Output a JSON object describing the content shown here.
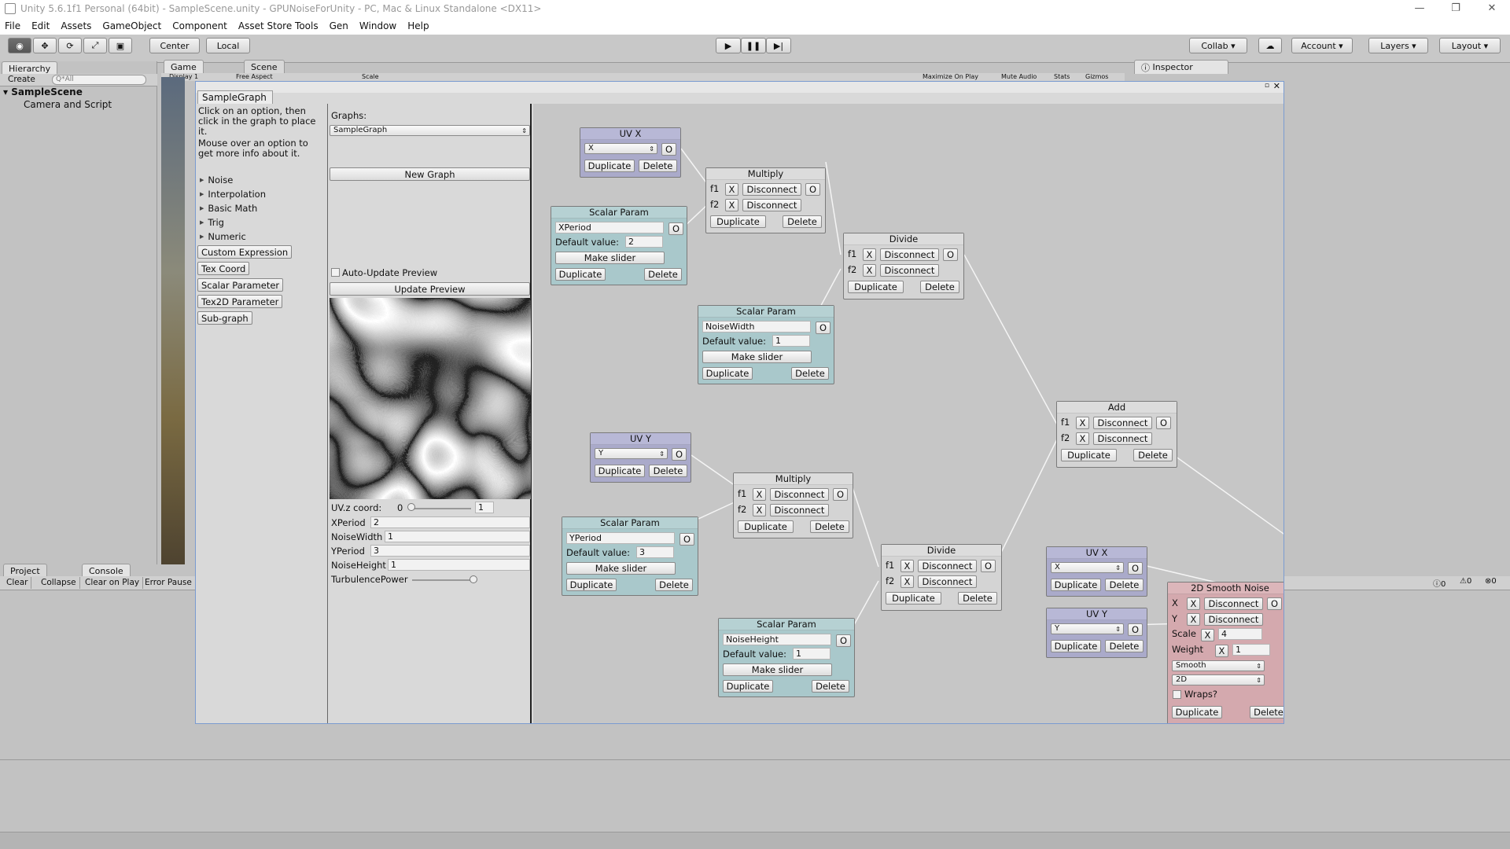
{
  "window": {
    "title": "Unity 5.6.1f1 Personal (64bit) - SampleScene.unity - GPUNoiseForUnity - PC, Mac & Linux Standalone <DX11>"
  },
  "menu": [
    "File",
    "Edit",
    "Assets",
    "GameObject",
    "Component",
    "Asset Store Tools",
    "Gen",
    "Window",
    "Help"
  ],
  "toolbar": {
    "center": "Center",
    "local": "Local",
    "collab": "Collab",
    "account": "Account",
    "layers": "Layers",
    "layout": "Layout"
  },
  "hierarchy": {
    "tab": "Hierarchy",
    "create": "Create",
    "search": "Q*All",
    "scene": "SampleScene",
    "item": "Camera and Script"
  },
  "tabs": {
    "game": "Game",
    "scene": "Scene",
    "inspector": "Inspector",
    "project": "Project",
    "console": "Console",
    "display": "Display 1",
    "aspect": "Free Aspect",
    "scale": "Scale",
    "maximize": "Maximize On Play",
    "mute": "Mute Audio",
    "stats": "Stats",
    "gizmos": "Gizmos"
  },
  "console": {
    "clear": "Clear",
    "collapse": "Collapse",
    "clear_on_play": "Clear on Play",
    "error_pause": "Error Pause",
    "count0": "0",
    "count1": "0",
    "count2": "0"
  },
  "editor": {
    "tab": "SampleGraph",
    "instructions1": "Click on an option, then click in the graph to place it.",
    "instructions2": "Mouse over an option to get more info about it.",
    "folds": [
      "Noise",
      "Interpolation",
      "Basic Math",
      "Trig",
      "Numeric"
    ],
    "buttons": [
      "Custom Expression",
      "Tex Coord",
      "Scalar Parameter",
      "Tex2D Parameter",
      "Sub-graph"
    ],
    "graphs_label": "Graphs:",
    "graph_select": "SampleGraph",
    "new_graph": "New Graph",
    "auto_update": "Auto-Update Preview",
    "update_preview": "Update Preview",
    "uvz_label": "UV.z coord:",
    "uvz_min": "0",
    "uvz_val": "1",
    "params": [
      {
        "name": "XPeriod",
        "value": "2"
      },
      {
        "name": "NoiseWidth",
        "value": "1"
      },
      {
        "name": "YPeriod",
        "value": "3"
      },
      {
        "name": "NoiseHeight",
        "value": "1"
      }
    ],
    "turbulence": "TurbulencePower"
  },
  "nodes": {
    "uvx": "UV X",
    "uvy": "UV Y",
    "multiply": "Multiply",
    "divide": "Divide",
    "add": "Add",
    "scalar": "Scalar Param",
    "smooth": "2D Smooth Noise",
    "x": "X",
    "y": "Y",
    "o": "O",
    "dup": "Duplicate",
    "del": "Delete",
    "disc": "Disconnect",
    "f1": "f1",
    "f2": "f2",
    "default_value": "Default value:",
    "make_slider": "Make slider",
    "xperiod": "XPeriod",
    "xperiod_v": "2",
    "noisewidth": "NoiseWidth",
    "noisewidth_v": "1",
    "yperiod": "YPeriod",
    "yperiod_v": "3",
    "noiseheight": "NoiseHeight",
    "noiseheight_v": "1",
    "scale": "Scale",
    "scale_v": "4",
    "weight": "Weight",
    "weight_v": "1",
    "smooth_mode": "Smooth",
    "dim": "2D",
    "wraps": "Wraps?"
  }
}
